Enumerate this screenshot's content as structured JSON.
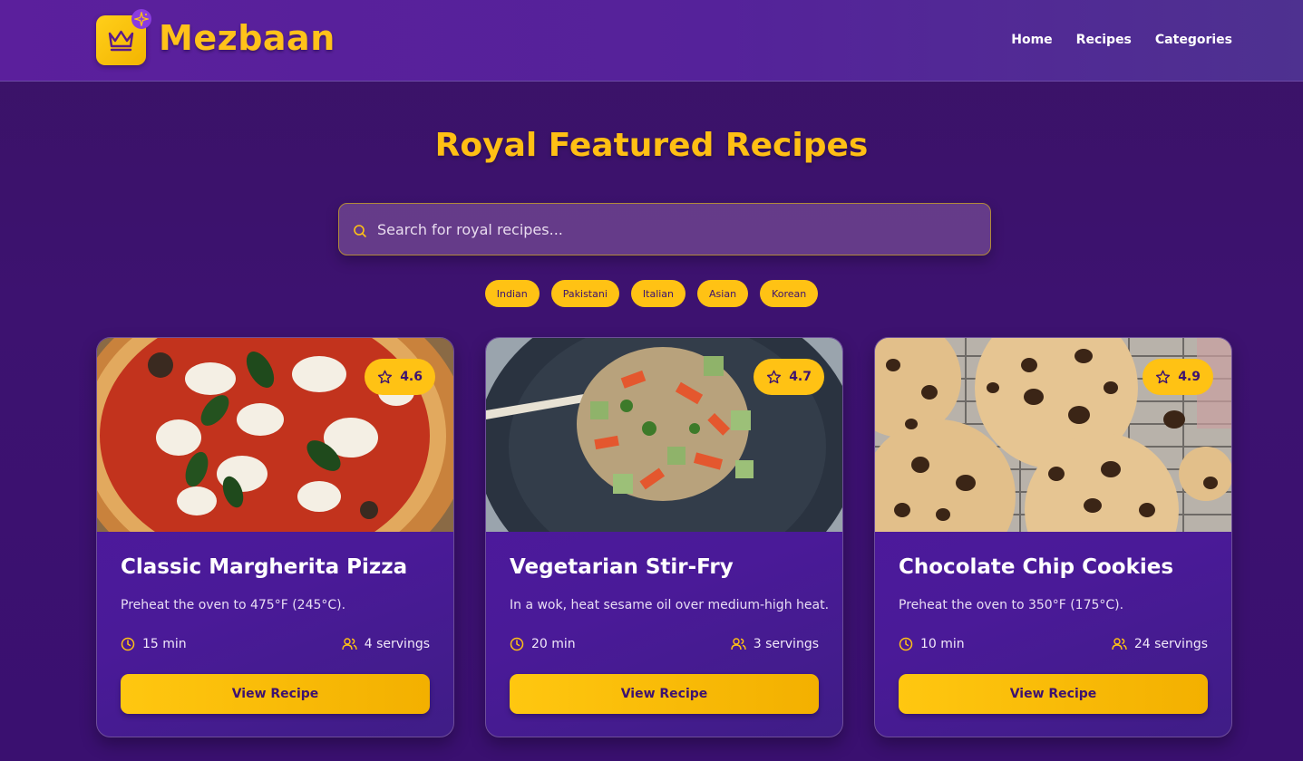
{
  "brand": {
    "name": "Mezbaan",
    "icon": "crown-icon",
    "badge_icon": "sparkle-icon"
  },
  "nav": {
    "items": [
      "Home",
      "Recipes",
      "Categories"
    ]
  },
  "hero": {
    "title": "Royal Featured Recipes",
    "search_placeholder": "Search for royal recipes..."
  },
  "categories": [
    "Indian",
    "Pakistani",
    "Italian",
    "Asian",
    "Korean"
  ],
  "recipes": [
    {
      "title": "Classic Margherita Pizza",
      "description": "Preheat the oven to 475°F (245°C).",
      "rating": "4.6",
      "time": "15 min",
      "servings": "4 servings",
      "button": "View Recipe",
      "image": "pizza-image"
    },
    {
      "title": "Vegetarian Stir-Fry",
      "description": "In a wok, heat sesame oil over medium-high heat.",
      "rating": "4.7",
      "time": "20 min",
      "servings": "3 servings",
      "button": "View Recipe",
      "image": "stir-fry-image"
    },
    {
      "title": "Chocolate Chip Cookies",
      "description": "Preheat the oven to 350°F (175°C).",
      "rating": "4.9",
      "time": "10 min",
      "servings": "24 servings",
      "button": "View Recipe",
      "image": "cookies-image"
    }
  ],
  "colors": {
    "accent": "#ffc214",
    "header": "#5b1f9c",
    "background": "#3a1366",
    "card": "#4f18a0"
  }
}
